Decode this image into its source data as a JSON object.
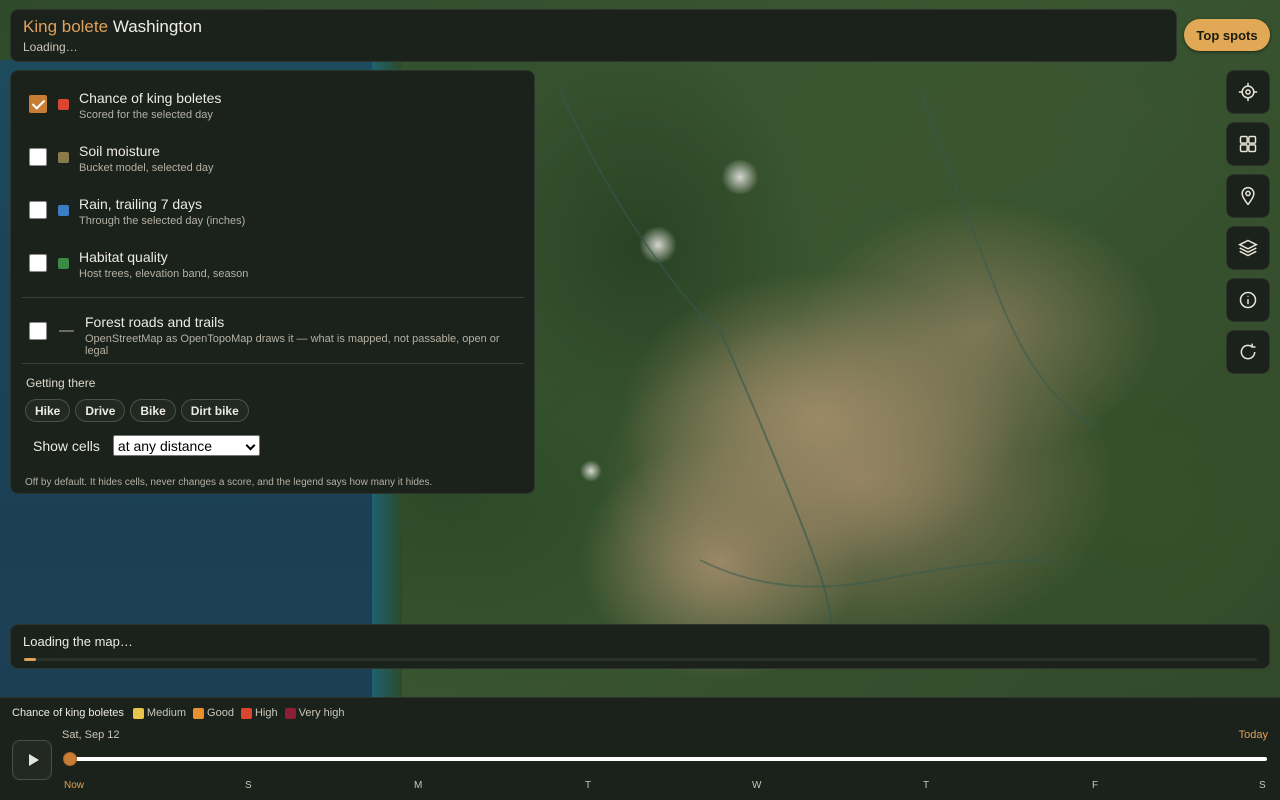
{
  "header": {
    "title_accent": "King bolete",
    "title_region": "Washington",
    "status": "Loading…"
  },
  "top_spots_label": "Top spots",
  "tools": [
    {
      "icon": "locate-icon"
    },
    {
      "icon": "grid-icon"
    },
    {
      "icon": "map-pin-icon"
    },
    {
      "icon": "layers-icon"
    },
    {
      "icon": "info-icon"
    },
    {
      "icon": "refresh-icon"
    }
  ],
  "layers": [
    {
      "title": "Chance of king boletes",
      "subtitle": "Scored for the selected day",
      "checked": true,
      "color": "#d9452f"
    },
    {
      "title": "Soil moisture",
      "subtitle": "Bucket model, selected day",
      "checked": false,
      "color": "#8a7a4a"
    },
    {
      "title": "Rain, trailing 7 days",
      "subtitle": "Through the selected day (inches)",
      "checked": false,
      "color": "#3a7dc4"
    },
    {
      "title": "Habitat quality",
      "subtitle": "Host trees, elevation band, season",
      "checked": false,
      "color": "#3a8a45"
    }
  ],
  "roads": {
    "title": "Forest roads and trails",
    "subtitle": "OpenStreetMap as OpenTopoMap draws it — what is mapped, not passable, open or legal",
    "checked": false
  },
  "getting_there": {
    "label": "Getting there",
    "modes": [
      "Hike",
      "Drive",
      "Bike",
      "Dirt bike"
    ]
  },
  "show_cells": {
    "label": "Show cells",
    "selected": "at any distance"
  },
  "footnote": "Off by default. It hides cells, never changes a score, and the legend says how many it hides.",
  "map_loading": {
    "text": "Loading the map…",
    "progress": 0.01
  },
  "legend": {
    "title": "Chance of king boletes",
    "items": [
      {
        "label": "Medium",
        "color": "#e8c54a"
      },
      {
        "label": "Good",
        "color": "#e88f2e"
      },
      {
        "label": "High",
        "color": "#d9452f"
      },
      {
        "label": "Very high",
        "color": "#8a1f35"
      }
    ]
  },
  "timeline": {
    "date": "Sat, Sep 12",
    "today": "Today",
    "days": [
      "Now",
      "S",
      "M",
      "T",
      "W",
      "T",
      "F",
      "S"
    ],
    "position": 0
  }
}
